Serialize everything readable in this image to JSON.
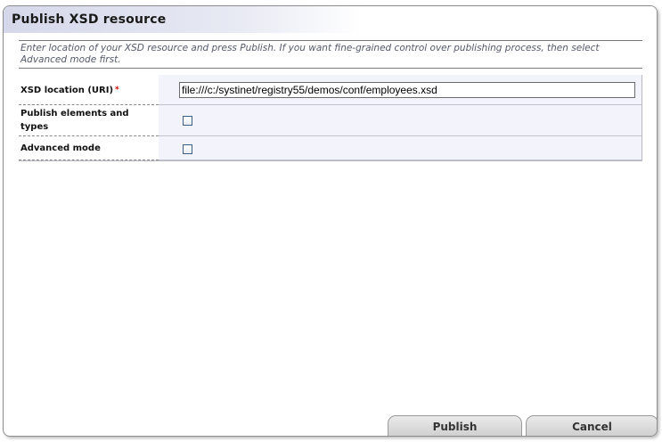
{
  "dialog": {
    "title": "Publish XSD resource",
    "info": "Enter location of your XSD resource and press Publish. If you want fine-grained control over publishing process, then select Advanced mode first."
  },
  "form": {
    "xsd_location": {
      "label": "XSD location (URI)",
      "required_mark": "*",
      "value": "file:///c:/systinet/registry55/demos/conf/employees.xsd"
    },
    "publish_elements": {
      "label": "Publish elements and types",
      "checked": false
    },
    "advanced_mode": {
      "label": "Advanced mode",
      "checked": false
    }
  },
  "buttons": {
    "publish": "Publish",
    "cancel": "Cancel"
  }
}
